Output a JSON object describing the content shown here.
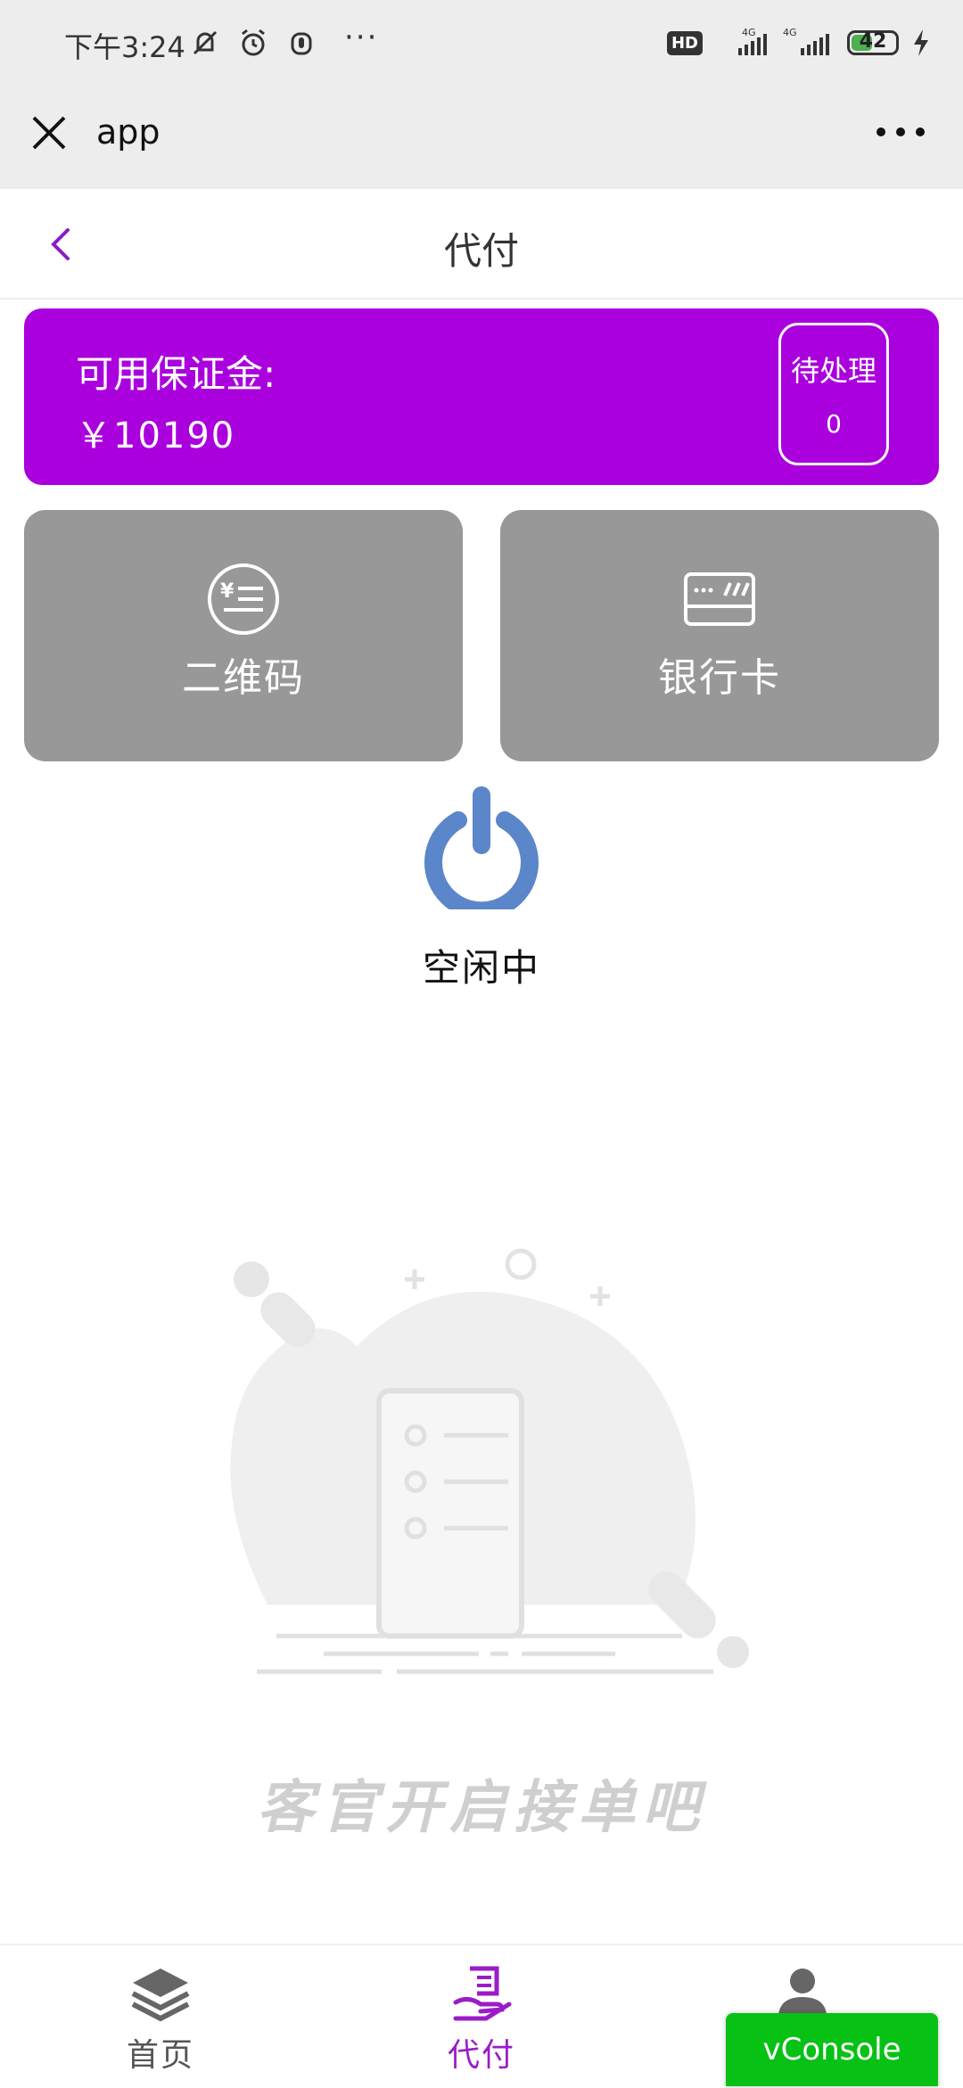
{
  "status_bar": {
    "time": "下午3:24",
    "dots": "···",
    "hd": "HD",
    "net1": "4G",
    "net2": "4G",
    "battery": "42"
  },
  "app_bar": {
    "title": "app"
  },
  "page": {
    "title": "代付"
  },
  "balance": {
    "label": "可用保证金:",
    "amount": "￥10190",
    "pending_label": "待处理",
    "pending_count": "0"
  },
  "methods": [
    {
      "label": "二维码",
      "icon": "yuan-list-icon"
    },
    {
      "label": "银行卡",
      "icon": "bank-card-icon"
    }
  ],
  "work_status": {
    "label": "空闲中",
    "icon": "power-icon",
    "color": "#5b86c9"
  },
  "empty_state": {
    "text": "客官开启接单吧"
  },
  "bottom_nav": [
    {
      "label": "首页",
      "icon": "layers-icon"
    },
    {
      "label": "代付",
      "icon": "pay-hand-icon",
      "active": true
    },
    {
      "label": "",
      "icon": "user-icon"
    }
  ],
  "vconsole": {
    "label": "vConsole"
  },
  "colors": {
    "accent": "#aa00dd",
    "tile": "#989898",
    "active_nav": "#9a1cc8",
    "vconsole": "#07c114"
  }
}
